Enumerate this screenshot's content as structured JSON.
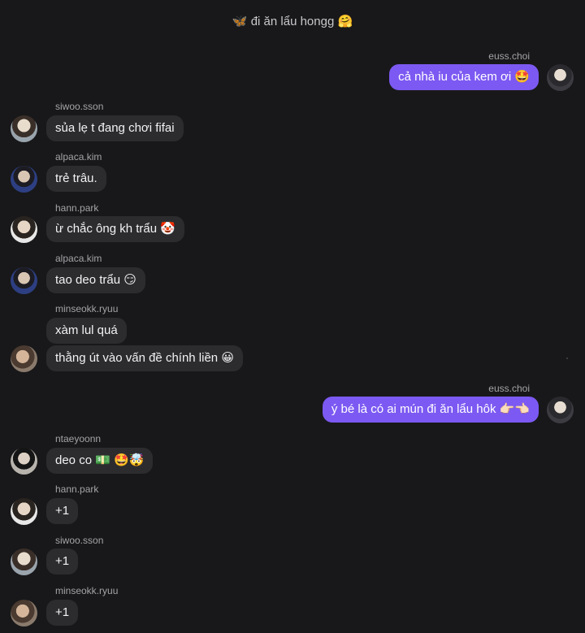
{
  "header": {
    "title": "đi ăn lẩu hongg",
    "leading_emoji": "🦋",
    "trailing_emoji": "🤗"
  },
  "messages": [
    {
      "sender": "euss.choi",
      "direction": "out",
      "text": "cả nhà iu của kem ơi 🤩"
    },
    {
      "sender": "siwoo.sson",
      "direction": "in",
      "text": "sủa lẹ t đang chơi fifai"
    },
    {
      "sender": "alpaca.kim",
      "direction": "in",
      "text": "trẻ trâu."
    },
    {
      "sender": "hann.park",
      "direction": "in",
      "text": "ừ chắc ông kh trẩu 🤡"
    },
    {
      "sender": "alpaca.kim",
      "direction": "in",
      "text": "tao deo trẩu 😏"
    },
    {
      "sender": "minseokk.ryuu",
      "direction": "in",
      "text": "xàm lul quá"
    },
    {
      "sender": "",
      "direction": "in",
      "text": "thằng út vào vấn đề chính liền 😀"
    },
    {
      "sender": "euss.choi",
      "direction": "out",
      "text": "ý bé là có ai mún đi ăn lẩu hôk 👉🏻👈🏻"
    },
    {
      "sender": "ntaeyoonn",
      "direction": "in",
      "text": "deo co 💵 🤩🤯"
    },
    {
      "sender": "hann.park",
      "direction": "in",
      "text": "+1"
    },
    {
      "sender": "siwoo.sson",
      "direction": "in",
      "text": "+1"
    },
    {
      "sender": "minseokk.ryuu",
      "direction": "in",
      "text": "+1"
    }
  ],
  "colors": {
    "background": "#18181a",
    "incoming_bubble": "#2c2c2f",
    "outgoing_bubble": "#7c59f2",
    "sender_name": "#a4a4a8",
    "text": "#f2f2f4"
  }
}
